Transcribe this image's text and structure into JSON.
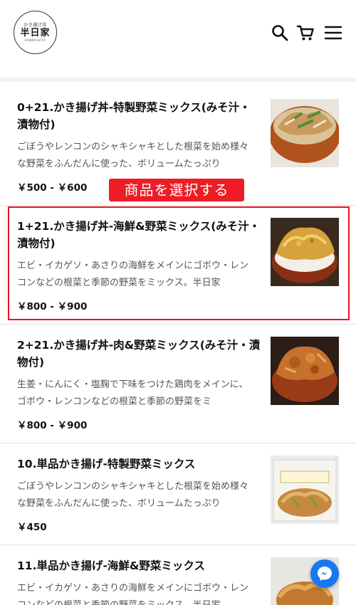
{
  "header": {
    "logo": {
      "top_text": "かき揚げ丼",
      "main_text": "半日家",
      "bottom_text": "HANNICHIYA"
    },
    "icons": [
      "search-icon",
      "cart-icon",
      "menu-icon"
    ]
  },
  "annotation": {
    "callout_text": "商品を選択する",
    "highlight_color": "#e8141d"
  },
  "items": [
    {
      "name": "0+21.かき揚げ丼-特製野菜ミックス(みそ汁・漬物付)",
      "description": "ごぼうやレンコンのシャキシャキとした根菜を始め様々な野菜をふんだんに使った、ボリュームたっぷり",
      "price": "￥500 - ￥600"
    },
    {
      "name": "1+21.かき揚げ丼-海鮮&野菜ミックス(みそ汁・漬物付)",
      "description": "エビ・イカゲソ・あさりの海鮮をメインにゴボウ・レンコンなどの根菜と季節の野菜をミックス。半日家",
      "price": "￥800 - ￥900"
    },
    {
      "name": "2+21.かき揚げ丼-肉&野菜ミックス(みそ汁・漬物付)",
      "description": "生姜・にんにく・塩麹で下味をつけた鶏肉をメインに、ゴボウ・レンコンなどの根菜と季節の野菜をミ",
      "price": "￥800 - ￥900"
    },
    {
      "name": "10.単品かき揚げ-特製野菜ミックス",
      "description": "ごぼうやレンコンのシャキシャキとした根菜を始め様々な野菜をふんだんに使った、ボリュームたっぷり",
      "price": "￥450"
    },
    {
      "name": "11.単品かき揚げ-海鮮&野菜ミックス",
      "description": "エビ・イカゲソ・あさりの海鮮をメインにゴボウ・レンコンなどの根菜と季節の野菜をミックス。半日家",
      "price": ""
    }
  ]
}
